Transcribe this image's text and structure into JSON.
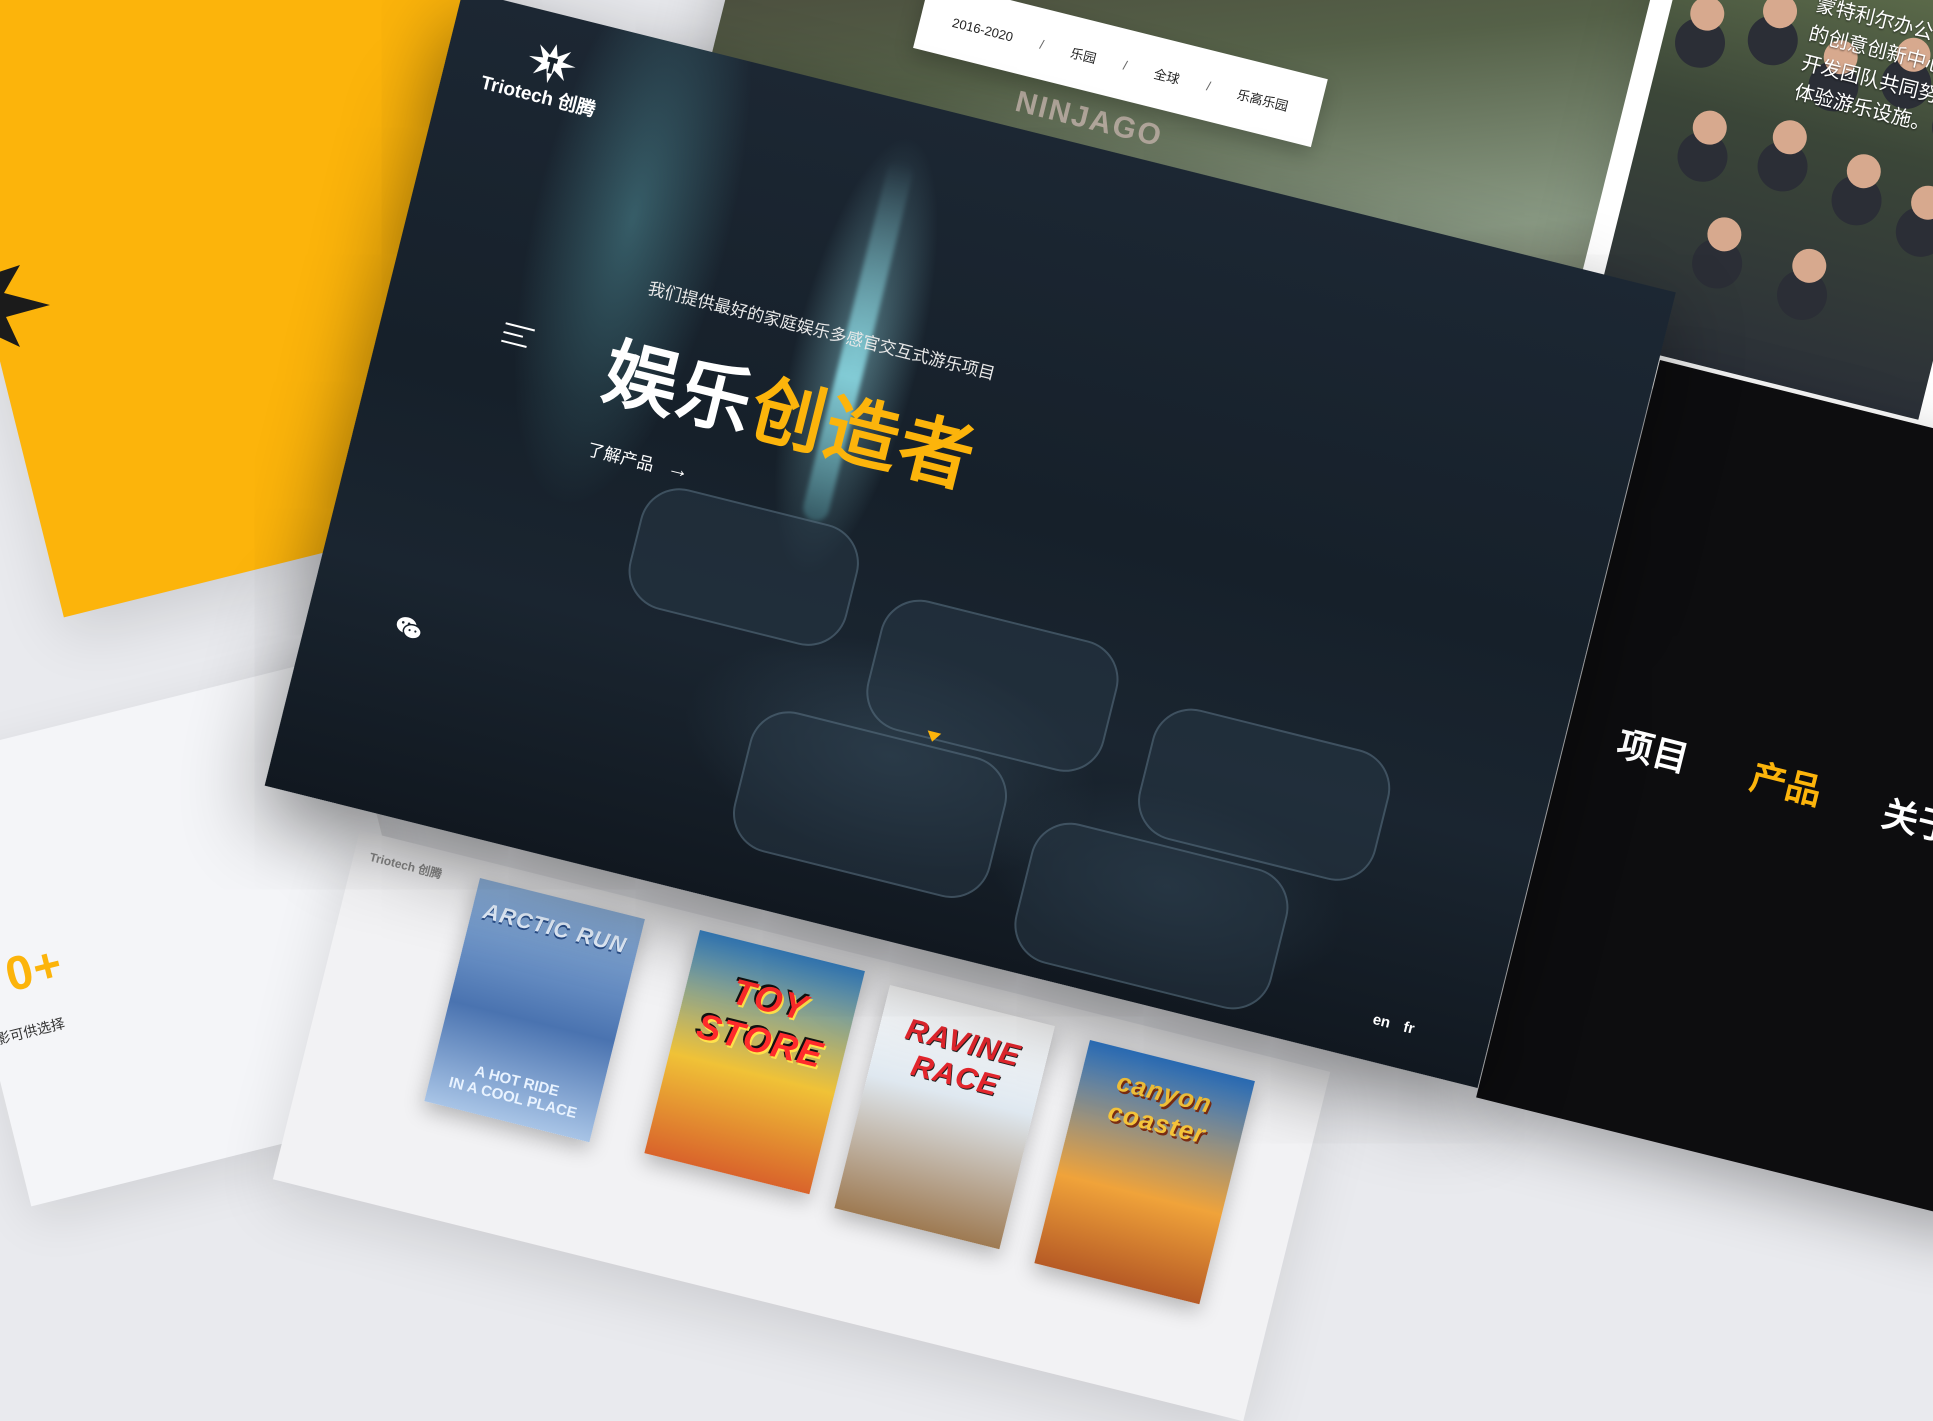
{
  "hero": {
    "logo": "Triotech 创腾",
    "tagline": "我们提供最好的家庭娱乐多感官交互式游乐项目",
    "title_white": "娱乐",
    "title_yellow": "创造者",
    "cta_label": "了解产品",
    "cta_arrow": "→",
    "lang": [
      "en",
      "fr"
    ],
    "menu_icon": "hamburger-menu-icon",
    "social_icon": "wechat-icon",
    "scroll_icon": "scroll-down-triangle-icon"
  },
  "history_card": {
    "tabs": [
      "2016-2020",
      "乐园",
      "全球",
      "乐高乐园"
    ],
    "separator": "/",
    "sign_text": "NINJAGO"
  },
  "team_card": {
    "text": "蒙特利尔办公\n的创意创新中心\n开发团队共同努\n体验游乐设施。"
  },
  "nav_card": {
    "items": [
      "项目",
      "产品",
      "关于"
    ]
  },
  "stats_card": {
    "number": "0+",
    "caption": "影可供选择"
  },
  "products_card": {
    "logo": "Triotech 创腾",
    "posters": [
      {
        "title": "ARCTIC RUN",
        "subtitle": "A HOT RIDE\nIN A COOL PLACE"
      },
      {
        "title": "TOY STORE",
        "subtitle": ""
      },
      {
        "title": "RAVINE RACE",
        "subtitle": ""
      },
      {
        "title": "canyon coaster",
        "subtitle": ""
      }
    ]
  },
  "colors": {
    "accent": "#fcb40b",
    "dark": "#0d0d0f",
    "hero_bg": "#16202a"
  }
}
